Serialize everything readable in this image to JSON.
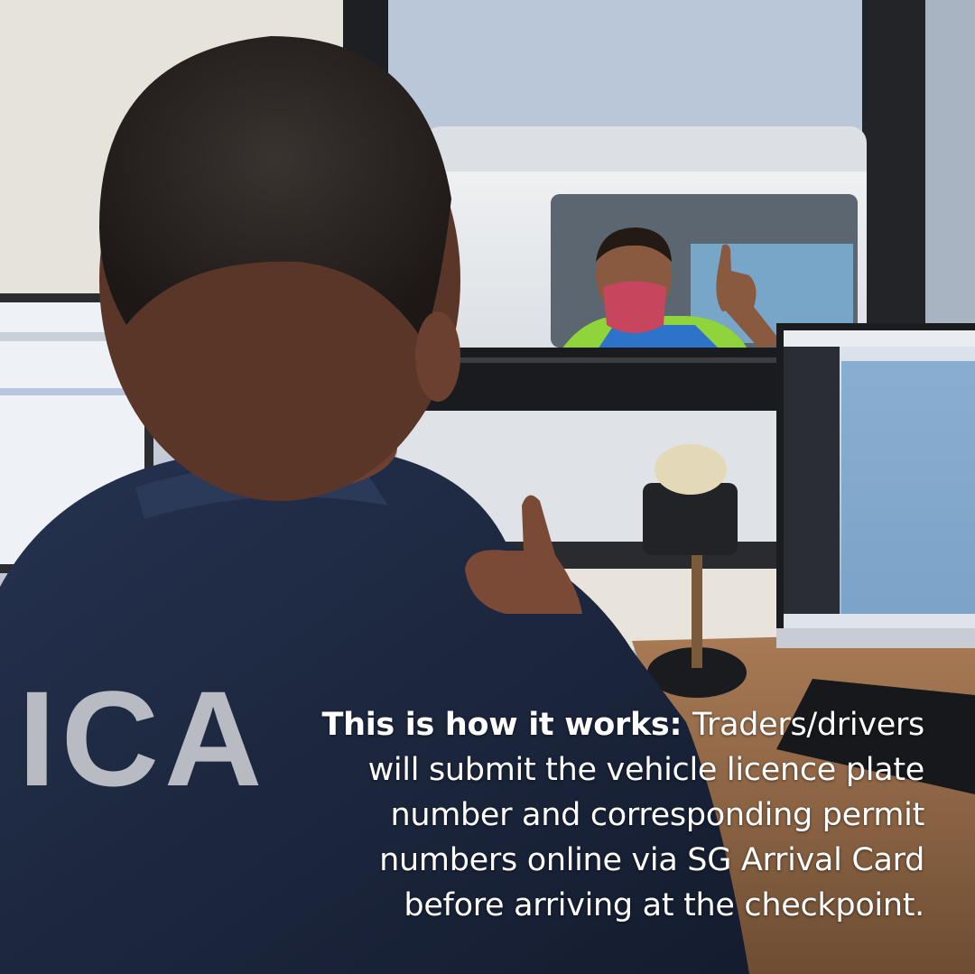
{
  "uniform": {
    "back_print": "ICA"
  },
  "caption": {
    "lead": "This is how it works:",
    "body": "Traders/drivers will submit the vehicle licence plate number and corresponding permit numbers online via SG Arrival Card before arriving at the checkpoint."
  },
  "colors": {
    "uniform_navy": "#1f2a44",
    "mask": "#c7455d",
    "hi_vis_vest": "#8fd43a",
    "caption_text": "#ffffff"
  }
}
